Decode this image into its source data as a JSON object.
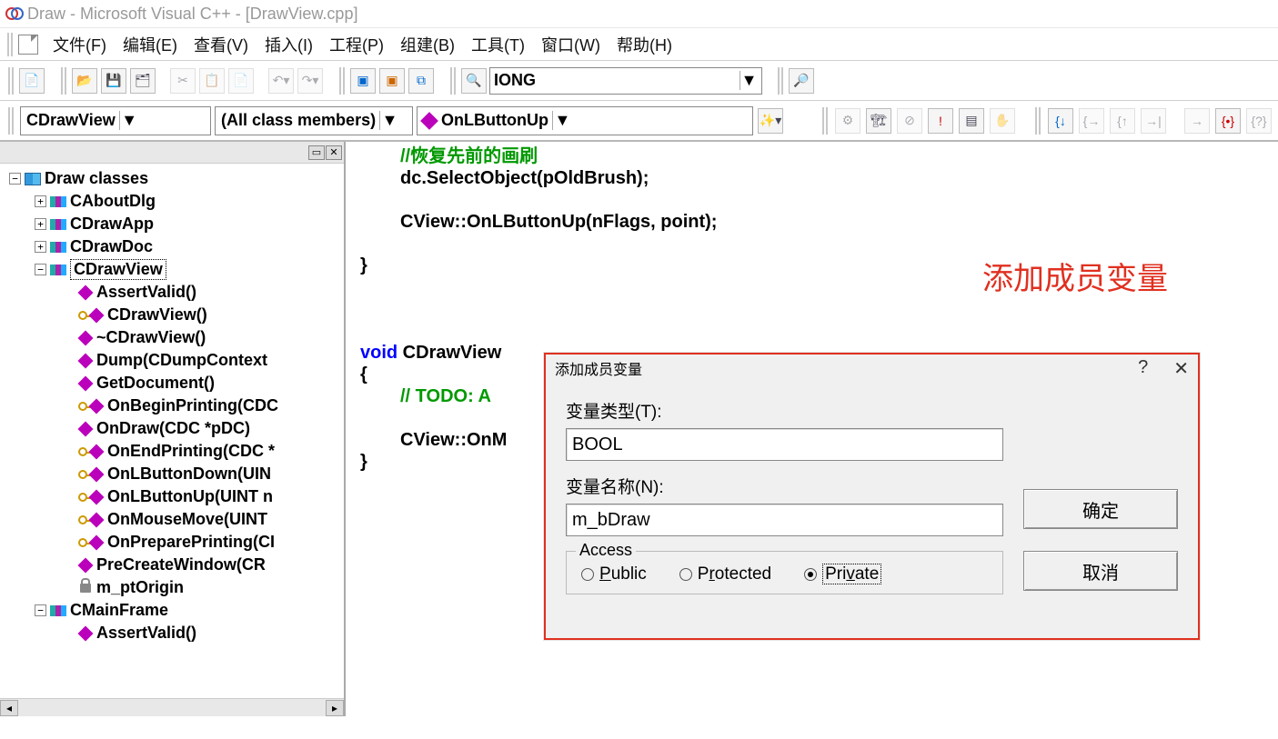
{
  "title": "Draw - Microsoft Visual C++ - [DrawView.cpp]",
  "menu": {
    "file": "文件(F)",
    "edit": "编辑(E)",
    "view": "查看(V)",
    "insert": "插入(I)",
    "project": "工程(P)",
    "build": "组建(B)",
    "tools": "工具(T)",
    "window": "窗口(W)",
    "help": "帮助(H)"
  },
  "toolbar": {
    "search_value": "IONG"
  },
  "combos": {
    "class": "CDrawView",
    "filter": "(All class members)",
    "member": "OnLButtonUp"
  },
  "tree": {
    "root": "Draw classes",
    "classes": [
      "CAboutDlg",
      "CDrawApp",
      "CDrawDoc",
      "CDrawView",
      "CMainFrame"
    ],
    "cdrawview_members": [
      {
        "k": "fn",
        "t": "AssertValid()"
      },
      {
        "k": "key",
        "t": "CDrawView()"
      },
      {
        "k": "fn",
        "t": "~CDrawView()"
      },
      {
        "k": "fn",
        "t": "Dump(CDumpContext"
      },
      {
        "k": "fn",
        "t": "GetDocument()"
      },
      {
        "k": "key",
        "t": "OnBeginPrinting(CDC"
      },
      {
        "k": "fn",
        "t": "OnDraw(CDC *pDC)"
      },
      {
        "k": "key",
        "t": "OnEndPrinting(CDC *"
      },
      {
        "k": "key",
        "t": "OnLButtonDown(UIN"
      },
      {
        "k": "key",
        "t": "OnLButtonUp(UINT n"
      },
      {
        "k": "key",
        "t": "OnMouseMove(UINT"
      },
      {
        "k": "key",
        "t": "OnPreparePrinting(CI"
      },
      {
        "k": "fn",
        "t": "PreCreateWindow(CR"
      },
      {
        "k": "lock",
        "t": "m_ptOrigin"
      }
    ],
    "cmainframe_members": [
      {
        "k": "fn",
        "t": "AssertValid()"
      }
    ]
  },
  "code": {
    "l1": "//恢复先前的画刷",
    "l2": "dc.SelectObject(pOldBrush);",
    "l3": "CView::OnLButtonUp(nFlags, point);",
    "l4": "}",
    "l5": "void",
    "l5b": " CDrawView",
    "l6": "{",
    "l7": "// TODO: A",
    "l8": "CView::OnM",
    "l9": "}"
  },
  "annotation": "添加成员变量",
  "dialog": {
    "title": "添加成员变量",
    "type_label": "变量类型(T):",
    "type_value": "BOOL",
    "name_label": "变量名称(N):",
    "name_value": "m_bDraw",
    "access_label": "Access",
    "public": "Public",
    "protected": "Protected",
    "private": "Private",
    "ok": "确定",
    "cancel": "取消"
  }
}
